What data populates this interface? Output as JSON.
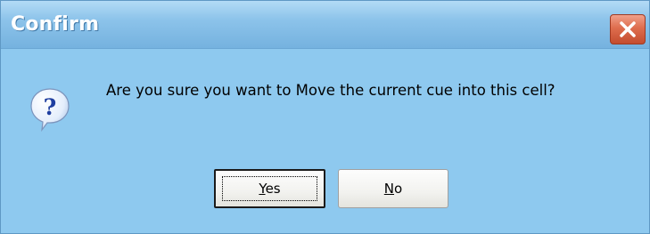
{
  "dialog": {
    "title": "Confirm",
    "message": "Are you sure you want to Move the current cue into this cell?",
    "icon": "question-icon",
    "close_icon": "close-icon"
  },
  "buttons": {
    "yes": {
      "mnemonic": "Y",
      "rest": "es",
      "label": "Yes"
    },
    "no": {
      "mnemonic": "N",
      "rest": "o",
      "label": "No"
    }
  },
  "colors": {
    "window_background": "#8ec9ef",
    "titlebar": "#75b2df",
    "title_text": "#ffffff",
    "close_button": "#de6d4e"
  }
}
